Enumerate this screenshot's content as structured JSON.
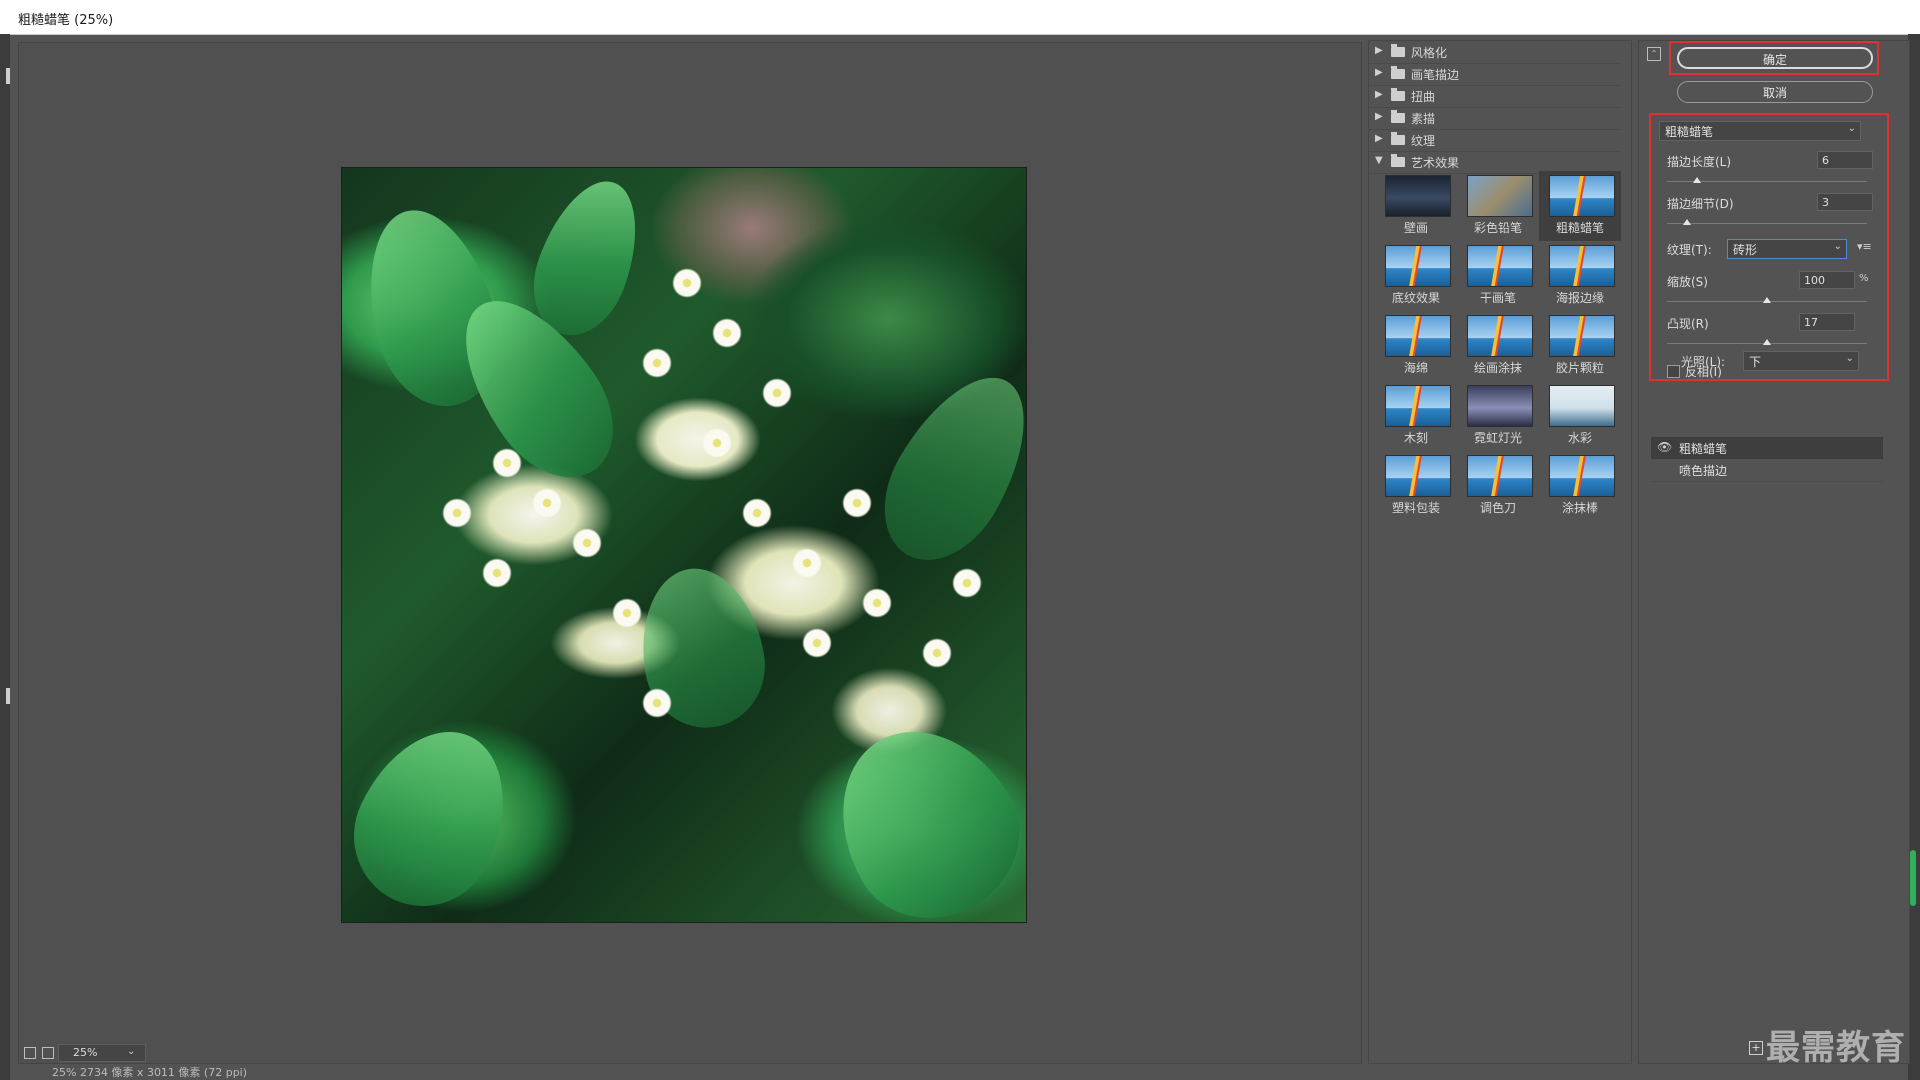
{
  "window": {
    "title": "粗糙蜡笔 (25%)"
  },
  "filter_categories": [
    {
      "label": "风格化",
      "expanded": false
    },
    {
      "label": "画笔描边",
      "expanded": false
    },
    {
      "label": "扭曲",
      "expanded": false
    },
    {
      "label": "素描",
      "expanded": false
    },
    {
      "label": "纹理",
      "expanded": false
    },
    {
      "label": "艺术效果",
      "expanded": true
    }
  ],
  "filter_thumbs": [
    {
      "label": "壁画"
    },
    {
      "label": "彩色铅笔"
    },
    {
      "label": "粗糙蜡笔",
      "selected": true
    },
    {
      "label": "底纹效果"
    },
    {
      "label": "干画笔"
    },
    {
      "label": "海报边缘"
    },
    {
      "label": "海绵"
    },
    {
      "label": "绘画涂抹"
    },
    {
      "label": "胶片颗粒"
    },
    {
      "label": "木刻"
    },
    {
      "label": "霓虹灯光"
    },
    {
      "label": "水彩"
    },
    {
      "label": "塑料包装"
    },
    {
      "label": "调色刀"
    },
    {
      "label": "涂抹棒"
    }
  ],
  "buttons": {
    "ok": "确定",
    "cancel": "取消"
  },
  "settings": {
    "filter_select": "粗糙蜡笔",
    "stroke_length": {
      "label": "描边长度(L)",
      "value": "6",
      "fraction": 0.15
    },
    "stroke_detail": {
      "label": "描边细节(D)",
      "value": "3",
      "fraction": 0.1
    },
    "texture": {
      "label": "纹理(T):",
      "value": "砖形"
    },
    "scaling": {
      "label": "缩放(S)",
      "value": "100",
      "unit": "%",
      "fraction": 0.5
    },
    "relief": {
      "label": "凸现(R)",
      "value": "17",
      "fraction": 0.5
    },
    "light": {
      "label": "光照(L):",
      "value": "下"
    },
    "invert": {
      "label": "反相(I)",
      "checked": false
    }
  },
  "effect_layers": [
    {
      "name": "粗糙蜡笔",
      "active": true
    },
    {
      "name": "喷色描边",
      "active": false
    }
  ],
  "zoom": {
    "value": "25%"
  },
  "status": {
    "text": "25% 2734 像素 x 3011 像素 (72 ppi)"
  },
  "watermark": "最需教育",
  "colors": {
    "highlight_box": "#e0312f",
    "background": "#535353",
    "title_bar": "#ffffff"
  }
}
